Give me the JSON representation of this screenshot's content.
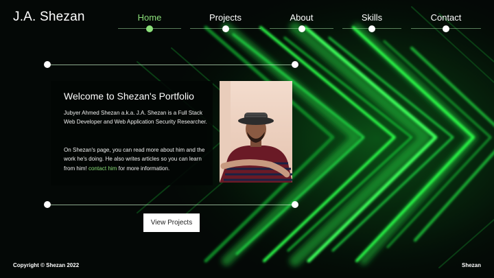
{
  "brand": "J.A. Shezan",
  "nav": {
    "items": [
      {
        "label": "Home",
        "active": true
      },
      {
        "label": "Projects",
        "active": false
      },
      {
        "label": "About",
        "active": false
      },
      {
        "label": "Skills",
        "active": false
      },
      {
        "label": "Contact",
        "active": false
      }
    ],
    "active_color": "#8be07a"
  },
  "hero": {
    "title": "Welcome to Shezan's Portfolio",
    "intro": "Jubyer Ahmed Shezan a.k.a. J.A. Shezan is a Full Stack Web Developer and Web Application Security Researcher.",
    "body_before": "On Shezan's page, you can read more about him and the work he's doing. He also writes articles so you can learn from him!",
    "contact_link": "contact him",
    "body_after": "for more information.",
    "cta_label": "View Projects",
    "photo": "profile-photo"
  },
  "footer": {
    "copyright": "Copyright © Shezan 2022",
    "brand": "Shezan"
  },
  "colors": {
    "background": "#040806",
    "accent": "#8be07a",
    "glow": "#2bff4a"
  }
}
